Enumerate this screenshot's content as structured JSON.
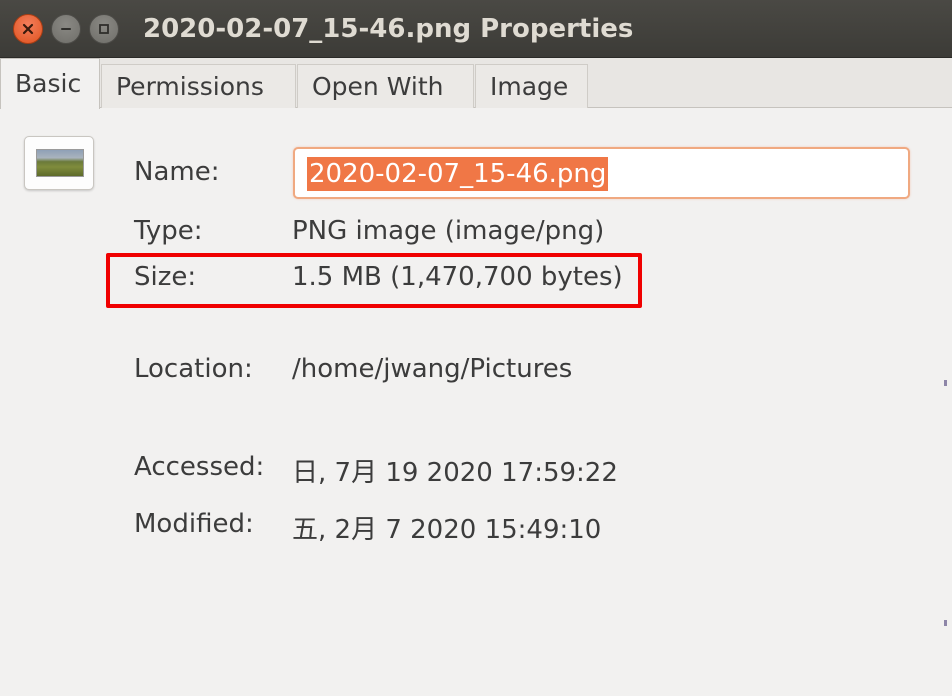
{
  "window": {
    "title": "2020-02-07_15-46.png Properties",
    "controls": [
      "close",
      "minimize",
      "maximize"
    ]
  },
  "tabs": [
    {
      "label": "Basic",
      "active": true
    },
    {
      "label": "Permissions",
      "active": false
    },
    {
      "label": "Open With",
      "active": false
    },
    {
      "label": "Image",
      "active": false
    }
  ],
  "basic": {
    "thumbnail_icon": "image-thumbnail",
    "name": {
      "label": "Name:",
      "value": "2020-02-07_15-46.png"
    },
    "type": {
      "label": "Type:",
      "value": "PNG image (image/png)"
    },
    "size": {
      "label": "Size:",
      "value": "1.5 MB (1,470,700 bytes)"
    },
    "location": {
      "label": "Location:",
      "value": "/home/jwang/Pictures"
    },
    "accessed": {
      "label": "Accessed:",
      "value": "日, 7月 19 2020 17:59:22"
    },
    "modified": {
      "label": "Modified:",
      "value": "五, 2月  7 2020 15:49:10"
    }
  },
  "colors": {
    "titlebar": "#3c3b37",
    "selection": "#f07746",
    "highlight_box": "#f00000",
    "background": "#f2f1f0"
  }
}
